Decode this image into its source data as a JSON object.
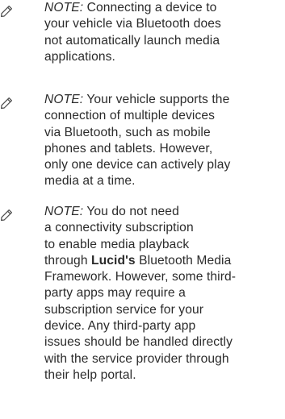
{
  "label": "NOTE:",
  "icon": "pencil-icon",
  "notes": [
    {
      "lines": [
        "Connecting a device to",
        "your vehicle via Bluetooth does",
        "not automatically launch media",
        "applications."
      ]
    },
    {
      "lines": [
        "Your vehicle supports the",
        "connection of multiple devices",
        "via Bluetooth, such as mobile",
        "phones and tablets. However,",
        "only one device can actively play",
        "media at a time."
      ]
    },
    {
      "lines": [
        "You do not need",
        "a connectivity subscription",
        "to enable media playback",
        "through",
        "Lucid's",
        "Bluetooth Media",
        "Framework. However, some third-",
        "party apps may require a",
        "subscription service for your",
        "device. Any third-party app",
        "issues should be handled directly",
        "with the service provider through",
        "their help portal."
      ]
    }
  ]
}
